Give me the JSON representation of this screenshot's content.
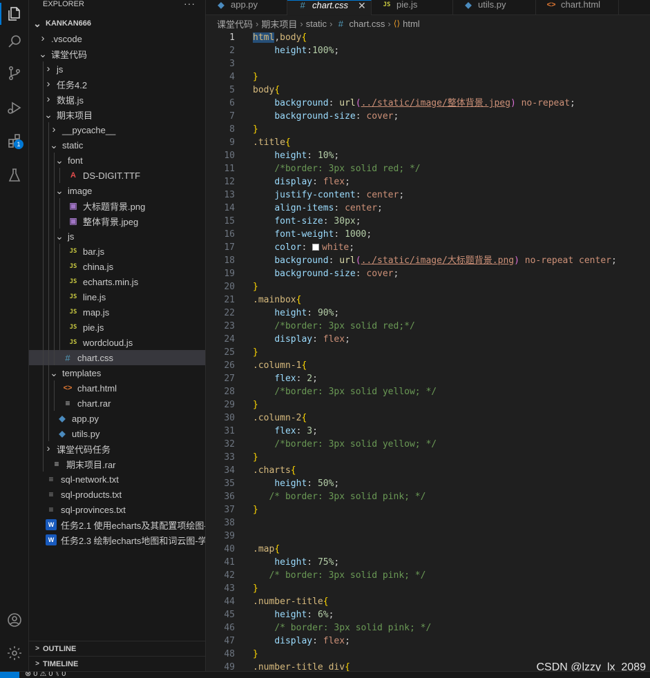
{
  "sidebar": {
    "title": "EXPLORER",
    "more": "···",
    "tree": [
      {
        "label": "KANKAN666",
        "indent": 0,
        "chev": "v",
        "icon": "",
        "bold": true
      },
      {
        "label": ".vscode",
        "indent": 1,
        "chev": ">",
        "icon": ""
      },
      {
        "label": "课堂代码",
        "indent": 1,
        "chev": "v",
        "icon": ""
      },
      {
        "label": "js",
        "indent": 2,
        "chev": ">",
        "icon": ""
      },
      {
        "label": "任务4.2",
        "indent": 2,
        "chev": ">",
        "icon": ""
      },
      {
        "label": "数据.js",
        "indent": 2,
        "chev": ">",
        "icon": ""
      },
      {
        "label": "期末项目",
        "indent": 2,
        "chev": "v",
        "icon": ""
      },
      {
        "label": "__pycache__",
        "indent": 3,
        "chev": ">",
        "icon": ""
      },
      {
        "label": "static",
        "indent": 3,
        "chev": "v",
        "icon": ""
      },
      {
        "label": "font",
        "indent": 4,
        "chev": "v",
        "icon": ""
      },
      {
        "label": "DS-DIGIT.TTF",
        "indent": 5,
        "chev": "",
        "icon": "font"
      },
      {
        "label": "image",
        "indent": 4,
        "chev": "v",
        "icon": ""
      },
      {
        "label": "大标题背景.png",
        "indent": 5,
        "chev": "",
        "icon": "img"
      },
      {
        "label": "整体背景.jpeg",
        "indent": 5,
        "chev": "",
        "icon": "img"
      },
      {
        "label": "js",
        "indent": 4,
        "chev": "v",
        "icon": ""
      },
      {
        "label": "bar.js",
        "indent": 5,
        "chev": "",
        "icon": "js"
      },
      {
        "label": "china.js",
        "indent": 5,
        "chev": "",
        "icon": "js"
      },
      {
        "label": "echarts.min.js",
        "indent": 5,
        "chev": "",
        "icon": "js"
      },
      {
        "label": "line.js",
        "indent": 5,
        "chev": "",
        "icon": "js"
      },
      {
        "label": "map.js",
        "indent": 5,
        "chev": "",
        "icon": "js"
      },
      {
        "label": "pie.js",
        "indent": 5,
        "chev": "",
        "icon": "js"
      },
      {
        "label": "wordcloud.js",
        "indent": 5,
        "chev": "",
        "icon": "js"
      },
      {
        "label": "chart.css",
        "indent": 4,
        "chev": "",
        "icon": "css",
        "selected": true
      },
      {
        "label": "templates",
        "indent": 3,
        "chev": "v",
        "icon": ""
      },
      {
        "label": "chart.html",
        "indent": 4,
        "chev": "",
        "icon": "html"
      },
      {
        "label": "chart.rar",
        "indent": 4,
        "chev": "",
        "icon": "rar"
      },
      {
        "label": "app.py",
        "indent": 3,
        "chev": "",
        "icon": "py"
      },
      {
        "label": "utils.py",
        "indent": 3,
        "chev": "",
        "icon": "py"
      },
      {
        "label": "课堂代码任务",
        "indent": 2,
        "chev": ">",
        "icon": ""
      },
      {
        "label": "期末项目.rar",
        "indent": 2,
        "chev": "",
        "icon": "rar"
      },
      {
        "label": "sql-network.txt",
        "indent": 1,
        "chev": "",
        "icon": "txt"
      },
      {
        "label": "sql-products.txt",
        "indent": 1,
        "chev": "",
        "icon": "txt"
      },
      {
        "label": "sql-provinces.txt",
        "indent": 1,
        "chev": "",
        "icon": "txt"
      },
      {
        "label": "任务2.1 使用echarts及其配置项绘图-...",
        "indent": 1,
        "chev": "",
        "icon": "word"
      },
      {
        "label": "任务2.3 绘制echarts地图和词云图-学...",
        "indent": 1,
        "chev": "",
        "icon": "word"
      }
    ],
    "outline_label": "OUTLINE",
    "timeline_label": "TIMELINE"
  },
  "activity_badge": "1",
  "tabs": [
    {
      "label": "app.py",
      "icon": "py",
      "active": false
    },
    {
      "label": "chart.css",
      "icon": "css",
      "active": true
    },
    {
      "label": "pie.js",
      "icon": "js",
      "active": false
    },
    {
      "label": "utils.py",
      "icon": "py",
      "active": false
    },
    {
      "label": "chart.html",
      "icon": "html",
      "active": false
    }
  ],
  "tab_close": "✕",
  "breadcrumb": [
    "课堂代码",
    "期末项目",
    "static",
    "chart.css",
    "html"
  ],
  "code_lines": [
    [
      [
        "s",
        "html"
      ],
      [
        "p",
        ","
      ],
      [
        "s",
        "body"
      ],
      [
        "b",
        "{"
      ]
    ],
    [
      [
        "t",
        "    "
      ],
      [
        "k",
        "height"
      ],
      [
        "p",
        ":"
      ],
      [
        "n",
        "100%"
      ],
      [
        "p",
        ";"
      ]
    ],
    [],
    [
      [
        "b",
        "}"
      ]
    ],
    [
      [
        "s",
        "body"
      ],
      [
        "b",
        "{"
      ]
    ],
    [
      [
        "t",
        "    "
      ],
      [
        "k",
        "background"
      ],
      [
        "p",
        ": "
      ],
      [
        "f",
        "url"
      ],
      [
        "r",
        "("
      ],
      [
        "u",
        "../static/image/整体背景.jpeg"
      ],
      [
        "r",
        ")"
      ],
      [
        "p",
        " "
      ],
      [
        "v",
        "no-repeat"
      ],
      [
        "p",
        ";"
      ]
    ],
    [
      [
        "t",
        "    "
      ],
      [
        "k",
        "background-size"
      ],
      [
        "p",
        ": "
      ],
      [
        "v",
        "cover"
      ],
      [
        "p",
        ";"
      ]
    ],
    [
      [
        "b",
        "}"
      ]
    ],
    [
      [
        "s",
        ".title"
      ],
      [
        "b",
        "{"
      ]
    ],
    [
      [
        "t",
        "    "
      ],
      [
        "k",
        "height"
      ],
      [
        "p",
        ": "
      ],
      [
        "n",
        "10%"
      ],
      [
        "p",
        ";"
      ]
    ],
    [
      [
        "t",
        "    "
      ],
      [
        "c",
        "/*border: 3px solid red; */"
      ]
    ],
    [
      [
        "t",
        "    "
      ],
      [
        "k",
        "display"
      ],
      [
        "p",
        ": "
      ],
      [
        "v",
        "flex"
      ],
      [
        "p",
        ";"
      ]
    ],
    [
      [
        "t",
        "    "
      ],
      [
        "k",
        "justify-content"
      ],
      [
        "p",
        ": "
      ],
      [
        "v",
        "center"
      ],
      [
        "p",
        ";"
      ]
    ],
    [
      [
        "t",
        "    "
      ],
      [
        "k",
        "align-items"
      ],
      [
        "p",
        ": "
      ],
      [
        "v",
        "center"
      ],
      [
        "p",
        ";"
      ]
    ],
    [
      [
        "t",
        "    "
      ],
      [
        "k",
        "font-size"
      ],
      [
        "p",
        ": "
      ],
      [
        "n",
        "30px"
      ],
      [
        "p",
        ";"
      ]
    ],
    [
      [
        "t",
        "    "
      ],
      [
        "k",
        "font-weight"
      ],
      [
        "p",
        ": "
      ],
      [
        "n",
        "1000"
      ],
      [
        "p",
        ";"
      ]
    ],
    [
      [
        "t",
        "    "
      ],
      [
        "k",
        "color"
      ],
      [
        "p",
        ": "
      ],
      [
        "w",
        ""
      ],
      [
        "v",
        "white"
      ],
      [
        "p",
        ";"
      ]
    ],
    [
      [
        "t",
        "    "
      ],
      [
        "k",
        "background"
      ],
      [
        "p",
        ": "
      ],
      [
        "f",
        "url"
      ],
      [
        "r",
        "("
      ],
      [
        "u",
        "../static/image/大标题背景.png"
      ],
      [
        "r",
        ")"
      ],
      [
        "p",
        " "
      ],
      [
        "v",
        "no-repeat center"
      ],
      [
        "p",
        ";"
      ]
    ],
    [
      [
        "t",
        "    "
      ],
      [
        "k",
        "background-size"
      ],
      [
        "p",
        ": "
      ],
      [
        "v",
        "cover"
      ],
      [
        "p",
        ";"
      ]
    ],
    [
      [
        "b",
        "}"
      ]
    ],
    [
      [
        "s",
        ".mainbox"
      ],
      [
        "b",
        "{"
      ]
    ],
    [
      [
        "t",
        "    "
      ],
      [
        "k",
        "height"
      ],
      [
        "p",
        ": "
      ],
      [
        "n",
        "90%"
      ],
      [
        "p",
        ";"
      ]
    ],
    [
      [
        "t",
        "    "
      ],
      [
        "c",
        "/*border: 3px solid red;*/"
      ]
    ],
    [
      [
        "t",
        "    "
      ],
      [
        "k",
        "display"
      ],
      [
        "p",
        ": "
      ],
      [
        "v",
        "flex"
      ],
      [
        "p",
        ";"
      ]
    ],
    [
      [
        "b",
        "}"
      ]
    ],
    [
      [
        "s",
        ".column-1"
      ],
      [
        "b",
        "{"
      ]
    ],
    [
      [
        "t",
        "    "
      ],
      [
        "k",
        "flex"
      ],
      [
        "p",
        ": "
      ],
      [
        "n",
        "2"
      ],
      [
        "p",
        ";"
      ]
    ],
    [
      [
        "t",
        "    "
      ],
      [
        "c",
        "/*border: 3px solid yellow; */"
      ]
    ],
    [
      [
        "b",
        "}"
      ]
    ],
    [
      [
        "s",
        ".column-2"
      ],
      [
        "b",
        "{"
      ]
    ],
    [
      [
        "t",
        "    "
      ],
      [
        "k",
        "flex"
      ],
      [
        "p",
        ": "
      ],
      [
        "n",
        "3"
      ],
      [
        "p",
        ";"
      ]
    ],
    [
      [
        "t",
        "    "
      ],
      [
        "c",
        "/*border: 3px solid yellow; */"
      ]
    ],
    [
      [
        "b",
        "}"
      ]
    ],
    [
      [
        "s",
        ".charts"
      ],
      [
        "b",
        "{"
      ]
    ],
    [
      [
        "t",
        "    "
      ],
      [
        "k",
        "height"
      ],
      [
        "p",
        ": "
      ],
      [
        "n",
        "50%"
      ],
      [
        "p",
        ";"
      ]
    ],
    [
      [
        "t",
        "   "
      ],
      [
        "c",
        "/* border: 3px solid pink; */"
      ]
    ],
    [
      [
        "b",
        "}"
      ]
    ],
    [],
    [],
    [
      [
        "s",
        ".map"
      ],
      [
        "b",
        "{"
      ]
    ],
    [
      [
        "t",
        "    "
      ],
      [
        "k",
        "height"
      ],
      [
        "p",
        ": "
      ],
      [
        "n",
        "75%"
      ],
      [
        "p",
        ";"
      ]
    ],
    [
      [
        "t",
        "   "
      ],
      [
        "c",
        "/* border: 3px solid pink; */"
      ]
    ],
    [
      [
        "b",
        "}"
      ]
    ],
    [
      [
        "s",
        ".number-title"
      ],
      [
        "b",
        "{"
      ]
    ],
    [
      [
        "t",
        "    "
      ],
      [
        "k",
        "height"
      ],
      [
        "p",
        ": "
      ],
      [
        "n",
        "6%"
      ],
      [
        "p",
        ";"
      ]
    ],
    [
      [
        "t",
        "    "
      ],
      [
        "c",
        "/* border: 3px solid pink; */"
      ]
    ],
    [
      [
        "t",
        "    "
      ],
      [
        "k",
        "display"
      ],
      [
        "p",
        ": "
      ],
      [
        "v",
        "flex"
      ],
      [
        "p",
        ";"
      ]
    ],
    [
      [
        "b",
        "}"
      ]
    ],
    [
      [
        "s",
        ".number-title div"
      ],
      [
        "b",
        "{"
      ]
    ]
  ],
  "watermark": "CSDN @lzzy_lx_2089",
  "status": "⊗ 0 ⚠ 0    ⑊ 0"
}
